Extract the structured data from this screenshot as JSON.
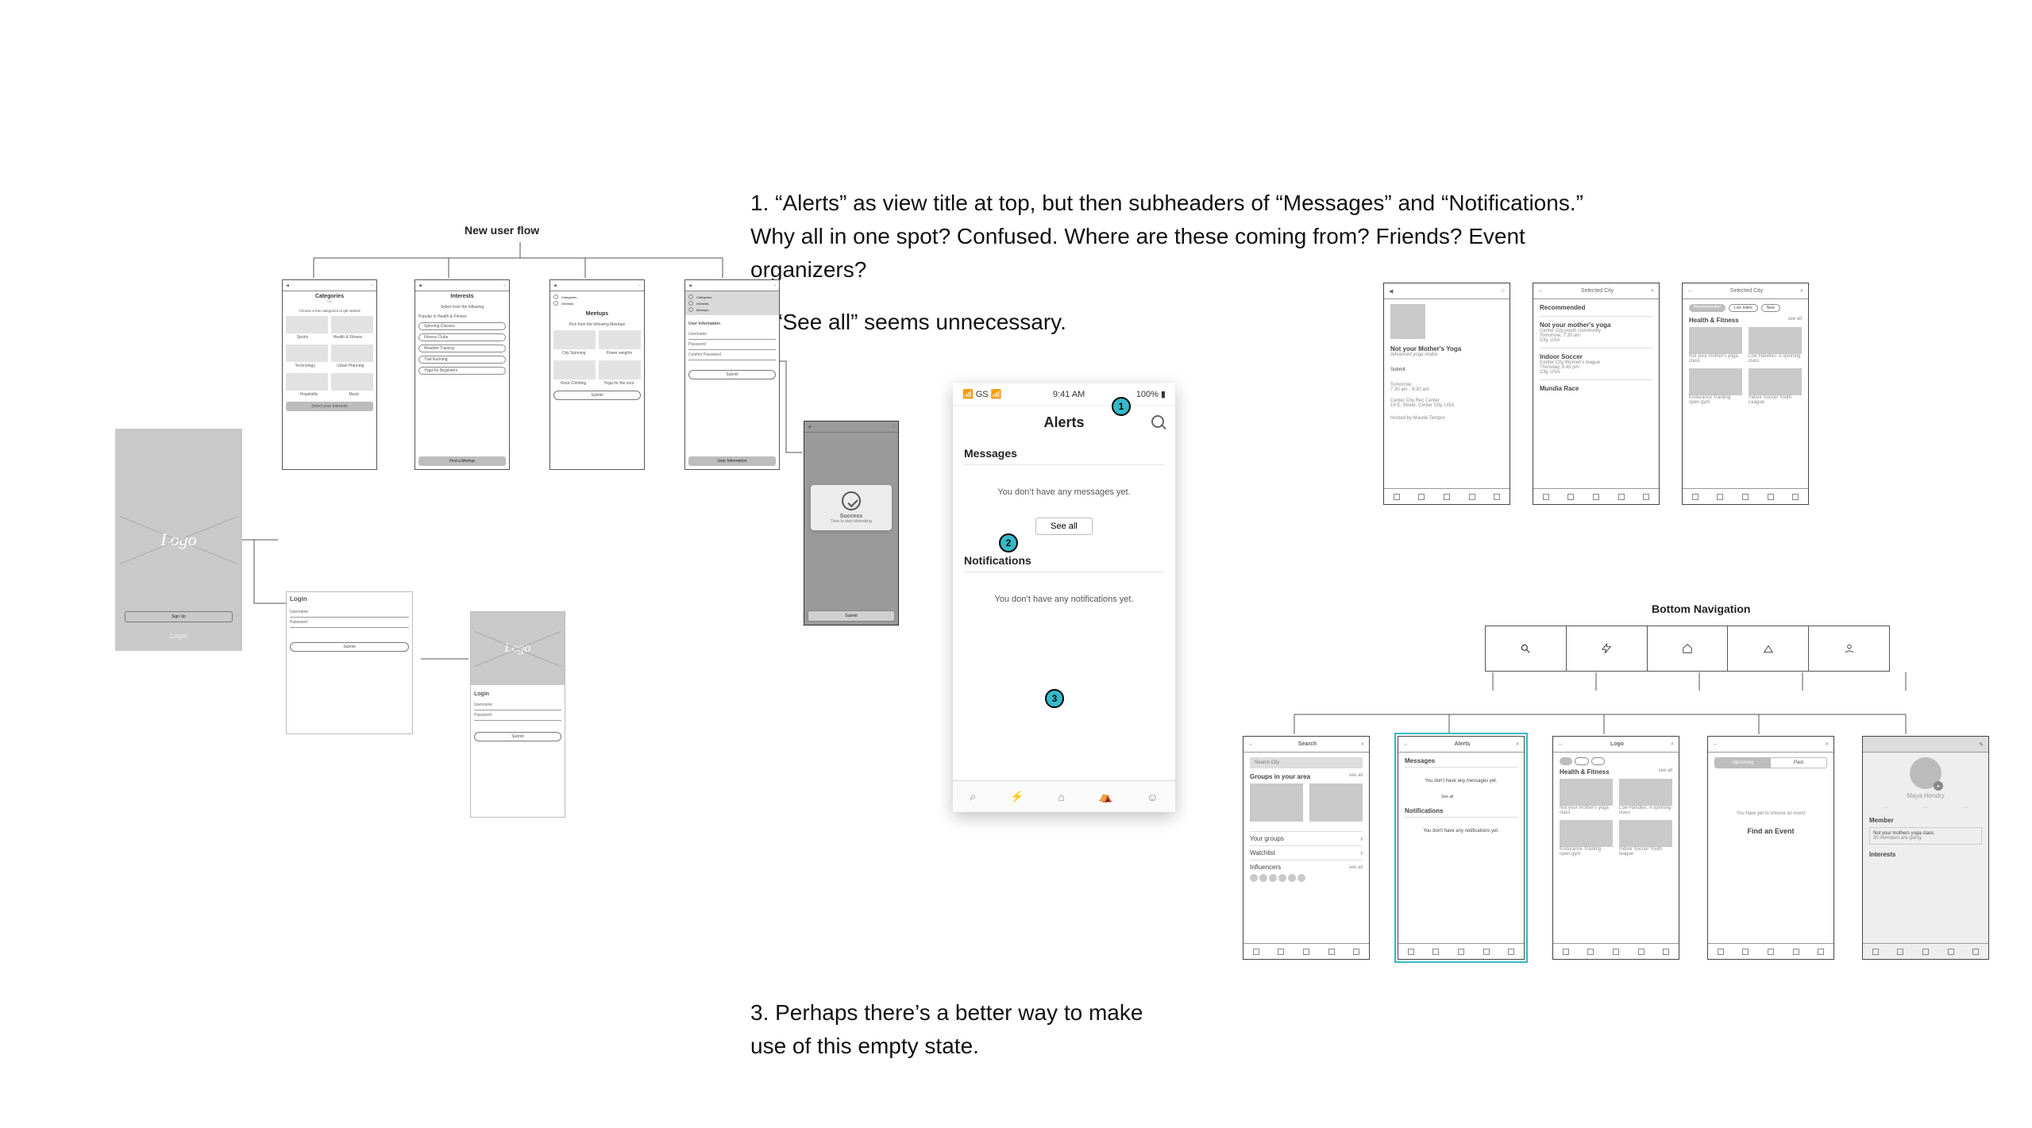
{
  "annotations": {
    "n1": "1. “Alerts” as view title at top, but then subheaders of “Messages” and “Notifications.” Why all in one spot? Confused. Where are these coming from? Friends? Event organizers?",
    "n2": "2. “See all” seems unnecessary.",
    "n3": "3. Perhaps there’s a better way to make use of this empty state."
  },
  "flow_label": "New user flow",
  "bignav_label": "Bottom Navigation",
  "markers": {
    "m1": "1",
    "m2": "2",
    "m3": "3"
  },
  "alerts_big": {
    "carrier": "📶 GS 📶",
    "time": "9:41 AM",
    "battery": "100% ▮",
    "title": "Alerts",
    "messages_header": "Messages",
    "messages_empty": "You don’t have any messages yet.",
    "see_all": "See all",
    "notifications_header": "Notifications",
    "notifications_empty": "You don’t have any notifications yet."
  },
  "left": {
    "splash_logo": "Logo",
    "signup": "Sign Up",
    "login_small": "Login",
    "categories": {
      "title": "Categories",
      "sub": "Choose a few categories to get started",
      "cats": [
        "Sports",
        "Health & Fitness",
        "Technology",
        "Urban Planning",
        "Hospitality",
        "Music"
      ],
      "cta": "Select your Interests"
    },
    "interests": {
      "title": "Interests",
      "sub": "Select from the following",
      "section": "Popular in Health & Fitness",
      "tags": [
        "Spinning Classes",
        "Fitness Clubs",
        "Weather Training",
        "Trail Running",
        "Yoga for Beginners"
      ],
      "cta": "Find a Meetup"
    },
    "meetups": {
      "title": "Meetups",
      "sub": "Pick from the following Meetups",
      "cells": [
        "City Spinning",
        "Power weights",
        "Rock Climbing",
        "Yoga for the soul"
      ],
      "cta": "Submit"
    },
    "userinfo": {
      "steps": [
        "Categories",
        "Interests",
        "Meetups"
      ],
      "title": "User Information",
      "fields": [
        "Username",
        "Password",
        "Confirm Password"
      ],
      "cta": "Submit"
    },
    "success": {
      "title": "Success",
      "sub": "Time to start elmosking",
      "cta": "Submit"
    },
    "login_panel": {
      "title": "Login",
      "u": "Username",
      "p": "Password",
      "cta": "Submit"
    },
    "splash2_login": {
      "logo": "Logo",
      "title": "Login",
      "u": "Username",
      "p": "Password",
      "cta": "Submit"
    }
  },
  "right_top": {
    "detail": {
      "title": "Not your Mother's Yoga",
      "sub": "Advanced yoga studio",
      "cta": "Submit",
      "when_label": "Tomorrow",
      "when_time": "7:30 am - 9:30 am",
      "venue": "Center City Rec Center",
      "addr": "19 E. Street, Center City, USA",
      "host": "Hosted by Maude Tempor"
    },
    "recs": {
      "top_city": "Selected City",
      "section": "Recommended",
      "items": [
        {
          "t": "Not your mother's yoga",
          "s": "Center City youth community",
          "d": "Tomorrow, 7:30 am",
          "c": "City, USA"
        },
        {
          "t": "Indoor Soccer",
          "s": "Center City Women's league",
          "d": "Thursday, 8:45 pm",
          "c": "City, USA"
        },
        {
          "t": "Mundia Race",
          "s": "",
          "d": "",
          "c": ""
        }
      ]
    },
    "home": {
      "top_city": "Selected City",
      "chips": [
        "Recommended",
        "Live Index",
        "New"
      ],
      "section": "Health & Fitness",
      "see_all": "see all",
      "cards": [
        {
          "t": "Not your mother's yoga class"
        },
        {
          "t": "Low Handles: A spinning class"
        },
        {
          "t": "Endurance Training: open gym"
        },
        {
          "t": "Indoor Soccer Youth League"
        }
      ]
    }
  },
  "bottom_row": {
    "search": {
      "title": "Search",
      "ph": "Search City",
      "groups": "Groups in your area",
      "see_all": "see all",
      "your_groups": "Your groups",
      "watchlist": "Watchlist",
      "influencers": "Influencers"
    },
    "alerts": {
      "title": "Alerts",
      "messages": "Messages",
      "m_empty": "You don't have any messages yet.",
      "see_all": "See all",
      "notifications": "Notifications",
      "n_empty": "You don't have any notifications yet."
    },
    "home": {
      "title": "Logo",
      "section": "Health & Fitness",
      "see_all": "see all",
      "cards": [
        "Not your mother's yoga class",
        "Low Handles: A spinning class",
        "Endurance Training open gym",
        "Indoor Soccer Youth league"
      ]
    },
    "events": {
      "tabs": [
        "Upcoming",
        "Past"
      ],
      "empty": "You have yet to choose an event",
      "cta": "Find an Event"
    },
    "profile": {
      "name": "Maya Hendry",
      "member": "Member",
      "group": "Not your mothers yoga class.",
      "going": "30 members are going.",
      "interests": "Interests"
    }
  }
}
